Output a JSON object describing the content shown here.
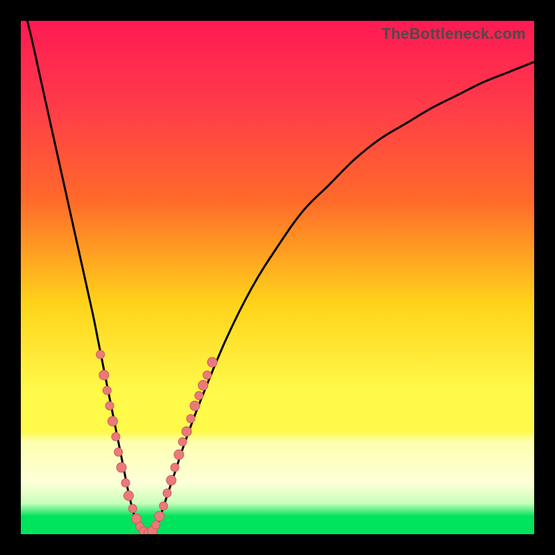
{
  "watermark": "TheBottleneck.com",
  "colors": {
    "frame": "#000000",
    "grad_top": "#ff1a53",
    "grad_mid1": "#ff6a2a",
    "grad_mid2": "#ffd31a",
    "grad_mid3": "#fff94a",
    "grad_light": "#fdffb0",
    "grad_green": "#00e35c",
    "curve": "#000000",
    "dot_fill": "#e97a7a",
    "dot_stroke": "#cf5a5a"
  },
  "chart_data": {
    "type": "line",
    "title": "",
    "xlabel": "",
    "ylabel": "",
    "xlim": [
      0,
      100
    ],
    "ylim": [
      0,
      100
    ],
    "series": [
      {
        "name": "bottleneck-curve",
        "x": [
          0,
          2,
          4,
          6,
          8,
          10,
          12,
          14,
          15,
          16,
          17,
          18,
          19,
          20,
          21,
          22,
          23,
          24,
          25,
          26,
          27,
          28,
          30,
          32,
          35,
          40,
          45,
          50,
          55,
          60,
          65,
          70,
          75,
          80,
          85,
          90,
          95,
          100
        ],
        "y": [
          105,
          97,
          88,
          79,
          70,
          61,
          52,
          43,
          38,
          33,
          28,
          23,
          18,
          13,
          8,
          4,
          1,
          0,
          0,
          1,
          3,
          6,
          12,
          18,
          26,
          38,
          48,
          56,
          63,
          68,
          73,
          77,
          80,
          83,
          85.5,
          88,
          90,
          92
        ]
      }
    ],
    "clusters": [
      {
        "name": "left-branch-points",
        "points": [
          {
            "x": 15.5,
            "y": 35,
            "r": 6
          },
          {
            "x": 16.2,
            "y": 31,
            "r": 7
          },
          {
            "x": 16.8,
            "y": 28,
            "r": 6
          },
          {
            "x": 17.3,
            "y": 25,
            "r": 6
          },
          {
            "x": 17.9,
            "y": 22,
            "r": 7
          },
          {
            "x": 18.5,
            "y": 19,
            "r": 6
          },
          {
            "x": 19.0,
            "y": 16,
            "r": 6
          },
          {
            "x": 19.6,
            "y": 13,
            "r": 7
          },
          {
            "x": 20.4,
            "y": 10,
            "r": 6
          },
          {
            "x": 21.0,
            "y": 7.5,
            "r": 7
          },
          {
            "x": 21.8,
            "y": 5,
            "r": 6
          },
          {
            "x": 22.5,
            "y": 3,
            "r": 7
          },
          {
            "x": 23.2,
            "y": 1.5,
            "r": 6
          }
        ]
      },
      {
        "name": "valley-points",
        "points": [
          {
            "x": 24.0,
            "y": 0.5,
            "r": 7
          },
          {
            "x": 24.8,
            "y": 0.3,
            "r": 6
          },
          {
            "x": 25.6,
            "y": 0.6,
            "r": 7
          }
        ]
      },
      {
        "name": "right-branch-points",
        "points": [
          {
            "x": 26.3,
            "y": 1.8,
            "r": 6
          },
          {
            "x": 27.0,
            "y": 3.5,
            "r": 7
          },
          {
            "x": 27.8,
            "y": 5.5,
            "r": 6
          },
          {
            "x": 28.5,
            "y": 8,
            "r": 6
          },
          {
            "x": 29.3,
            "y": 10.5,
            "r": 7
          },
          {
            "x": 30.0,
            "y": 13,
            "r": 6
          },
          {
            "x": 30.8,
            "y": 15.5,
            "r": 7
          },
          {
            "x": 31.5,
            "y": 18,
            "r": 6
          },
          {
            "x": 32.3,
            "y": 20,
            "r": 7
          },
          {
            "x": 33.1,
            "y": 22.5,
            "r": 6
          },
          {
            "x": 33.9,
            "y": 25,
            "r": 7
          },
          {
            "x": 34.7,
            "y": 27,
            "r": 6
          },
          {
            "x": 35.5,
            "y": 29,
            "r": 7
          },
          {
            "x": 36.3,
            "y": 31,
            "r": 6
          },
          {
            "x": 37.3,
            "y": 33.5,
            "r": 7
          }
        ]
      }
    ],
    "gradient_bands": [
      {
        "pos": 0.0,
        "desc": "vivid red-pink"
      },
      {
        "pos": 0.35,
        "desc": "orange"
      },
      {
        "pos": 0.6,
        "desc": "yellow"
      },
      {
        "pos": 0.82,
        "desc": "pale yellow"
      },
      {
        "pos": 0.96,
        "desc": "bright green"
      }
    ]
  }
}
